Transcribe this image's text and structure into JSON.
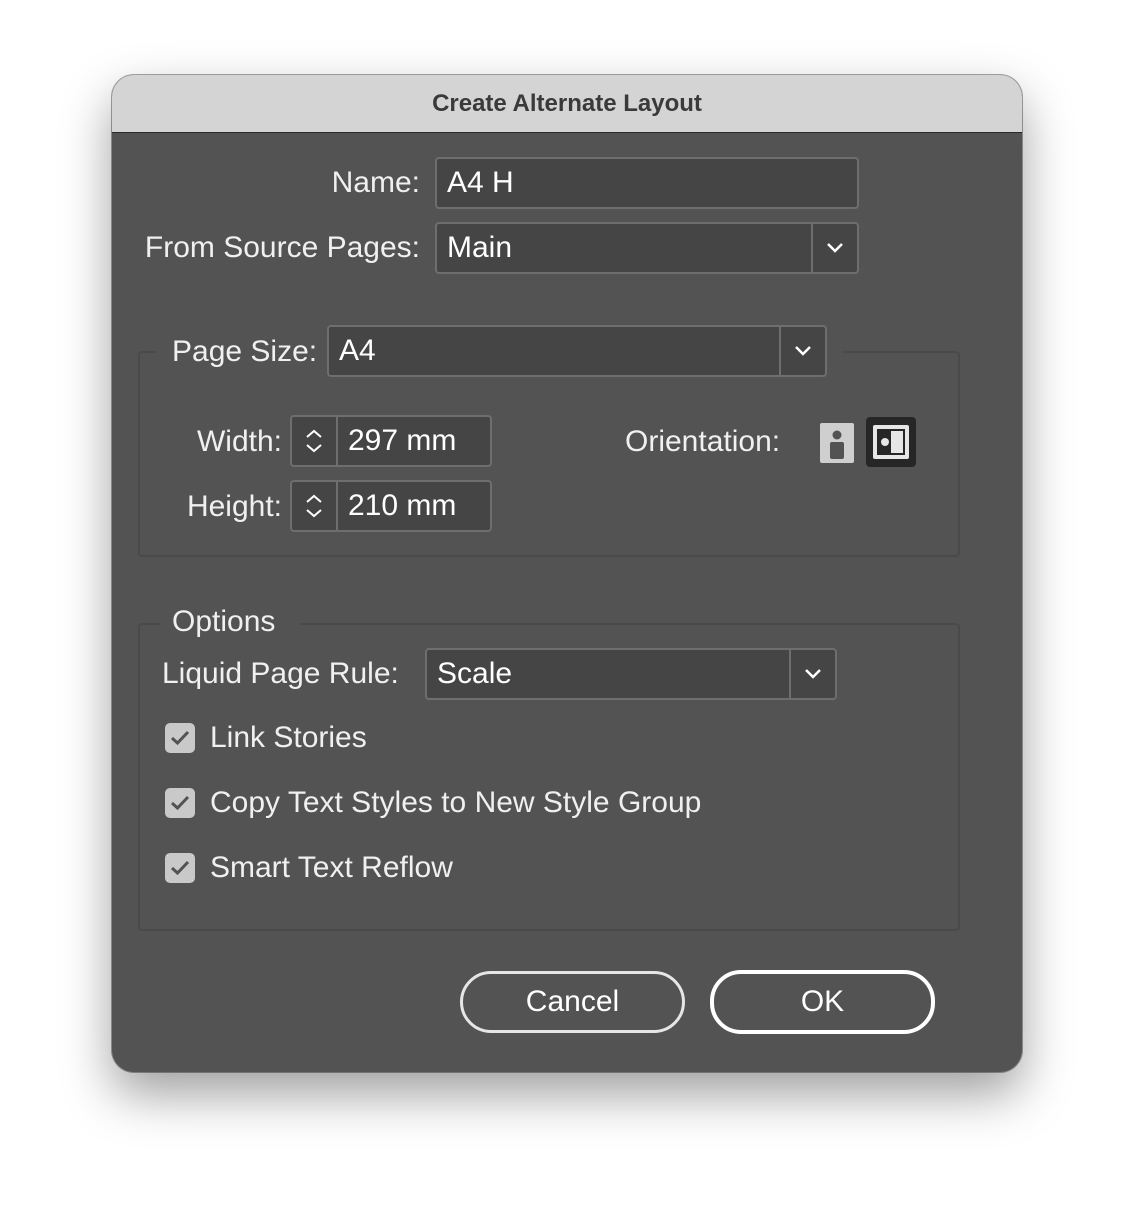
{
  "dialog": {
    "title": "Create Alternate Layout"
  },
  "name": {
    "label": "Name:",
    "value": "A4 H"
  },
  "source_pages": {
    "label": "From Source Pages:",
    "value": "Main"
  },
  "page_size": {
    "label": "Page Size:",
    "value": "A4"
  },
  "width": {
    "label": "Width:",
    "value": "297 mm"
  },
  "height": {
    "label": "Height:",
    "value": "210 mm"
  },
  "orientation": {
    "label": "Orientation:",
    "selected": "landscape"
  },
  "options": {
    "title": "Options",
    "liquid_rule_label": "Liquid Page Rule:",
    "liquid_rule_value": "Scale",
    "link_stories": {
      "label": "Link Stories",
      "checked": true
    },
    "copy_styles": {
      "label": "Copy Text Styles to New Style Group",
      "checked": true
    },
    "smart_reflow": {
      "label": "Smart Text Reflow",
      "checked": true
    }
  },
  "buttons": {
    "cancel": "Cancel",
    "ok": "OK"
  }
}
